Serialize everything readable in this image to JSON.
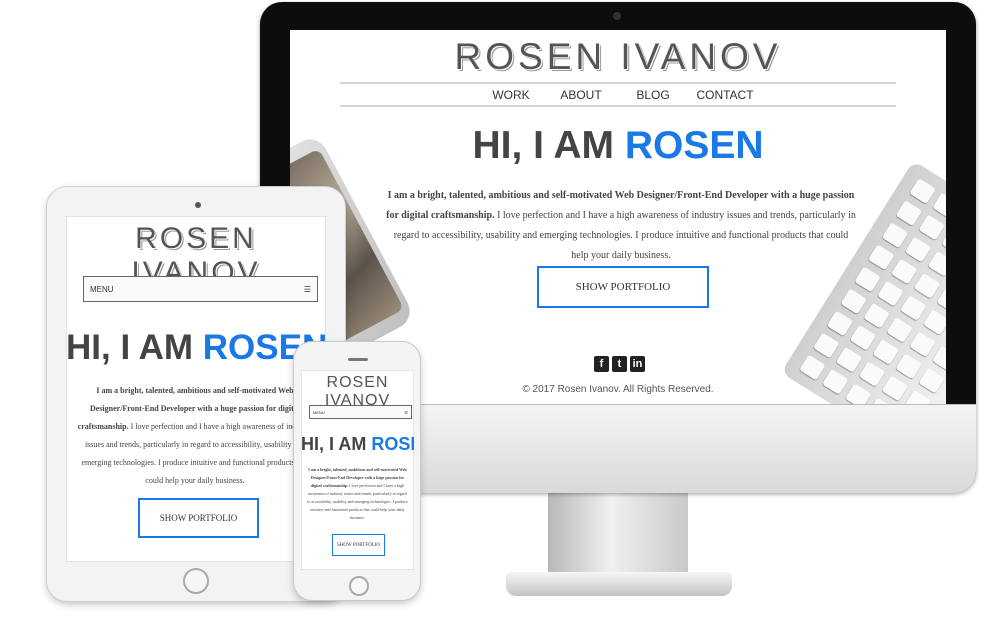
{
  "site": {
    "logo": "ROSEN IVANOV",
    "nav": [
      "WORK",
      "ABOUT",
      "BLOG",
      "CONTACT"
    ],
    "menu_label": "MENU",
    "menu_icon": "hamburger-icon",
    "hero_prefix": "HI, I AM ",
    "hero_name": "ROSEN",
    "intro_bold": "I am a bright, talented, ambitious and self-motivated Web Designer/Front-End Developer with a huge passion for digital craftsmanship.",
    "intro_rest": "I love perfection and I have a high awareness of industry issues and trends, particularly in regard to accessibility, usability and emerging technologies. I produce intuitive and functional products that could help your daily business.",
    "portfolio_button": "SHOW PORTFOLIO",
    "social": [
      "f",
      "t",
      "in"
    ],
    "social_icons": [
      "facebook-icon",
      "twitter-icon",
      "linkedin-icon"
    ],
    "footer": "© 2017 Rosen Ivanov. All Rights Reserved."
  },
  "colors": {
    "accent": "#1979e6",
    "text": "#444444"
  }
}
